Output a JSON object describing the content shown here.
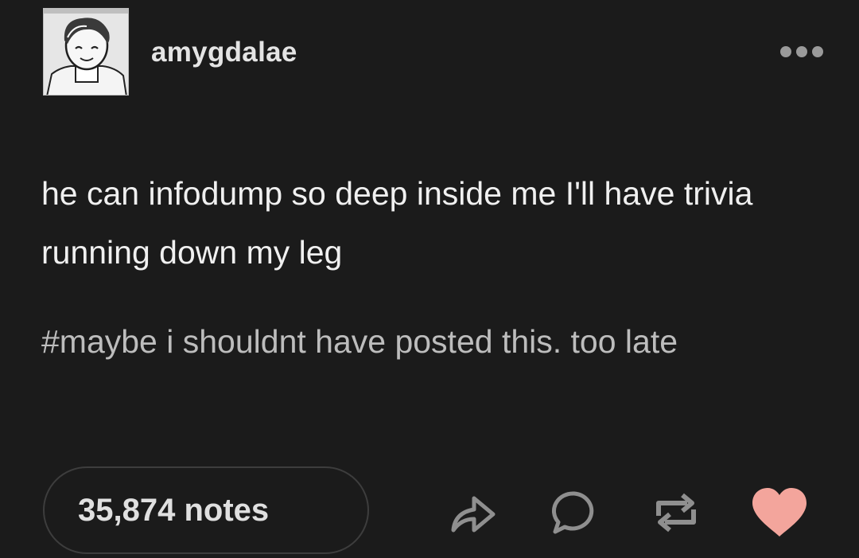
{
  "post": {
    "username": "amygdalae",
    "body": "he can infodump so deep inside me I'll have trivia running down my leg",
    "tags": "#maybe i shouldnt have posted this. too late",
    "notes_label": "35,874 notes"
  },
  "icons": {
    "more": "more-options-icon",
    "share": "share-icon",
    "reply": "reply-icon",
    "reblog": "reblog-icon",
    "like": "heart-icon"
  },
  "colors": {
    "background": "#1b1b1b",
    "text": "#f0f0f0",
    "tag_text": "#bdbdbd",
    "icon": "#8f8f8f",
    "heart": "#f3a59c"
  }
}
